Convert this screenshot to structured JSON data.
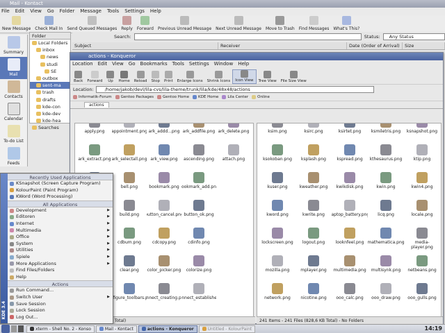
{
  "kontact": {
    "title": "Mail - Kontact",
    "menu": [
      "File",
      "Edit",
      "View",
      "Go",
      "Folder",
      "Message",
      "Tools",
      "Settings",
      "Help"
    ],
    "toolbar": [
      "New Message",
      "Check Mail In",
      "Send Queued Messages",
      "Reply",
      "Forward",
      "Previous Unread Message",
      "Next Unread Message",
      "Move to Trash",
      "Find Messages",
      "What's This?"
    ],
    "sidebar": [
      "Summary",
      "Mail",
      "Contacts",
      "Calendar",
      "To-do List",
      "Feeds"
    ],
    "folder_header": "Folder",
    "folders": [
      "Local Folders",
      "inbox",
      "news",
      "studi",
      "SE",
      "outbox",
      "sent-ma",
      "trash",
      "drafts",
      "kde-con",
      "kde-dev",
      "kde-hea",
      "Searches"
    ],
    "search_label": "Search:",
    "status_label": "Status:",
    "status_value": "Any Status",
    "columns": [
      "Subject",
      "Receiver",
      "Date (Order of Arrival)",
      "Size"
    ]
  },
  "konq": {
    "title": "actions - Konqueror",
    "menu": [
      "Location",
      "Edit",
      "View",
      "Go",
      "Bookmarks",
      "Tools",
      "Settings",
      "Window",
      "Help"
    ],
    "toolbar": [
      "Back",
      "Forward",
      "Up",
      "Home",
      "Reload",
      "Stop",
      "Print",
      "Enlarge Icons",
      "Shrink Icons",
      "Icon View",
      "Tree View",
      "File Size View"
    ],
    "location_label": "Location:",
    "location_value": "/home/jakob/devl/lila-cvs/lila-theme/trunk/lila/kde/48x48/actions",
    "bookmarks": [
      "Informatik-Forum",
      "Gentoo Packages",
      "Gentoo Home",
      "KDE Home",
      "Lila Center",
      "Online"
    ],
    "tab": "actions",
    "left_files": [
      "apply.png",
      "appointment.png",
      "ark_addd...png",
      "ark_addfile.png",
      "ark_delete.png",
      "ark_extract.png",
      "ark_selectall.png",
      "ark_view.png",
      "ascending.png",
      "attach.png",
      "back.png",
      "bell.png",
      "bookmark.png",
      "bookmark_add.png",
      "",
      "bottom.png",
      "build.png",
      "button_cancel.png",
      "button_ok.png",
      "",
      "cd.png",
      "cdbum.png",
      "cdcopy.png",
      "cdinfo.png",
      "",
      "centrejust.png",
      "clear.png",
      "color_picker.png",
      "colorize.png",
      "",
      "configure_shortcuts...",
      "configure_toolbars.png",
      "connect_creating.png",
      "connect_establishe...",
      ""
    ],
    "right_files": [
      "ksim.png",
      "ksirc.png",
      "ksirtet.png",
      "ksmiletris.png",
      "ksnapshot.png",
      "ksokoban.png",
      "ksplash.png",
      "kspread.png",
      "kthesaurus.png",
      "ktip.png",
      "kuser.png",
      "kweather.png",
      "kwikdisk.png",
      "kwin.png",
      "kwin4.png",
      "kword.png",
      "kwrite.png",
      "laptop_battery.png",
      "licq.png",
      "locale.png",
      "lockscreen.png",
      "logout.png",
      "looknfeel.png",
      "mathematica.png",
      "media-player.png",
      "mozilla.png",
      "mplayer.png",
      "multimedia.png",
      "multisynk.png",
      "netbeans.png",
      "network.png",
      "nicotine.png",
      "ooo_calc.png",
      "ooo_draw.png",
      "ooo_gulls.png"
    ],
    "status_left": "260 Files (826,0 KB Total)",
    "status_right": "241 Items - 241 Files (828,6 KB Total) - No Folders"
  },
  "kmenu": {
    "brand": "KDE 3.4",
    "recent_header": "Recently Used Applications",
    "recent": [
      "KSnapshot (Screen Capture Program)",
      "KolourPaint (Paint Program)",
      "KWord (Word Processing)"
    ],
    "all_header": "All Applications",
    "all": [
      "Development",
      "Editoren",
      "Internet",
      "Multimedia",
      "Office",
      "System",
      "Utilities",
      "Spiele",
      "More Applications",
      "Find Files/Folders",
      "Help"
    ],
    "actions_header": "Actions",
    "actions": [
      "Run Command...",
      "Switch User",
      "Save Session",
      "Lock Session",
      "Log Out..."
    ]
  },
  "taskbar": {
    "tasks": [
      "xterm - Shell No. 2 - Konso",
      "Mail - Kontact",
      "actions - Konqueror",
      "Untitled - KolourPaint"
    ],
    "clock": "14:19"
  },
  "colors": {
    "accent": "#4a62a0",
    "menu_stripe": "#3a5aa0"
  }
}
